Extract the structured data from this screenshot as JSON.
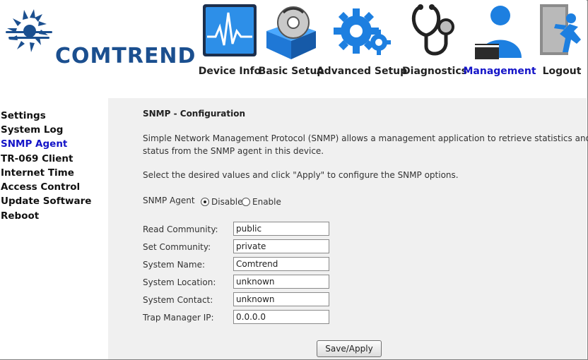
{
  "brand": {
    "name": "COMTREND"
  },
  "nav": {
    "items": [
      {
        "label": "Device Info",
        "icon": "monitor-chart-icon"
      },
      {
        "label": "Basic Setup",
        "icon": "box-disc-icon"
      },
      {
        "label": "Advanced Setup",
        "icon": "gears-icon"
      },
      {
        "label": "Diagnostics",
        "icon": "stethoscope-icon"
      },
      {
        "label": "Management",
        "icon": "user-laptop-icon",
        "active": true
      },
      {
        "label": "Logout",
        "icon": "exit-door-icon"
      }
    ]
  },
  "sidebar": {
    "items": [
      {
        "label": "Settings"
      },
      {
        "label": "System Log"
      },
      {
        "label": "SNMP Agent",
        "active": true
      },
      {
        "label": "TR-069 Client"
      },
      {
        "label": "Internet Time"
      },
      {
        "label": "Access Control"
      },
      {
        "label": "Update Software"
      },
      {
        "label": "Reboot"
      }
    ]
  },
  "page": {
    "title": "SNMP - Configuration",
    "desc_line1": "Simple Network Management Protocol (SNMP) allows a management application to retrieve statistics and",
    "desc_line2": "status from the SNMP agent in this device.",
    "instruction": "Select the desired values and click \"Apply\" to configure the SNMP options.",
    "agent": {
      "label": "SNMP Agent",
      "disable": "Disable",
      "enable": "Enable",
      "selected": "Disable"
    },
    "fields": [
      {
        "label": "Read Community:",
        "value": "public"
      },
      {
        "label": "Set Community:",
        "value": "private"
      },
      {
        "label": "System Name:",
        "value": "Comtrend"
      },
      {
        "label": "System Location:",
        "value": "unknown"
      },
      {
        "label": "System Contact:",
        "value": "unknown"
      },
      {
        "label": "Trap Manager IP:",
        "value": "0.0.0.0"
      }
    ],
    "apply_label": "Save/Apply"
  },
  "colors": {
    "active_link": "#1414c8",
    "brand_blue": "#1b4f8f",
    "icon_blue": "#1d7fe0",
    "content_bg": "#f0f0f0"
  }
}
